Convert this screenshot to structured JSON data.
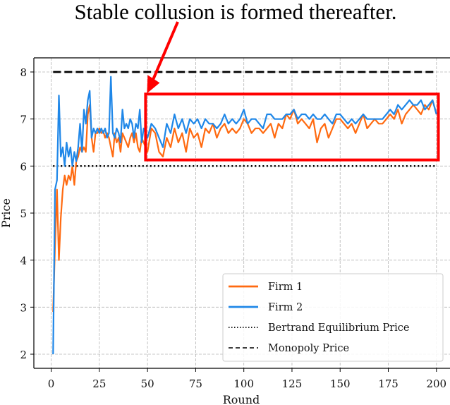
{
  "chart_data": {
    "type": "line",
    "title": "",
    "xlabel": "Round",
    "ylabel": "Price",
    "xlim": [
      -9,
      208.5
    ],
    "ylim": [
      1.7,
      8.3
    ],
    "xticks": [
      0,
      25,
      50,
      75,
      100,
      125,
      150,
      175,
      200
    ],
    "yticks": [
      2,
      3,
      4,
      5,
      6,
      7,
      8
    ],
    "grid": true,
    "legend_position": "bottom-right",
    "annotation": {
      "text": "Stable collusion is formed thereafter.",
      "box": {
        "x_range": [
          49,
          201
        ],
        "y_range": [
          6.13,
          7.53
        ],
        "color": "#ff0000"
      },
      "arrow_color": "#ff0000"
    },
    "reference_lines": [
      {
        "name": "Bertrand Equilibrium Price",
        "value": 6.0,
        "style": "dotted",
        "color": "#000000"
      },
      {
        "name": "Monopoly Price",
        "value": 8.0,
        "style": "dashed",
        "color": "#000000"
      }
    ],
    "x": [
      1,
      2,
      3,
      4,
      5,
      6,
      7,
      8,
      9,
      10,
      11,
      12,
      13,
      14,
      15,
      16,
      17,
      18,
      19,
      20,
      21,
      22,
      23,
      24,
      25,
      26,
      27,
      28,
      29,
      30,
      31,
      32,
      33,
      34,
      35,
      36,
      37,
      38,
      39,
      40,
      41,
      42,
      43,
      44,
      45,
      46,
      47,
      48,
      49,
      50,
      52,
      54,
      56,
      58,
      60,
      62,
      64,
      66,
      68,
      70,
      72,
      74,
      76,
      78,
      80,
      82,
      84,
      86,
      88,
      90,
      92,
      94,
      96,
      98,
      100,
      102,
      104,
      106,
      108,
      110,
      112,
      114,
      116,
      118,
      120,
      122,
      124,
      126,
      128,
      130,
      132,
      134,
      136,
      138,
      140,
      142,
      144,
      146,
      148,
      150,
      152,
      154,
      156,
      158,
      160,
      162,
      164,
      166,
      168,
      170,
      172,
      174,
      176,
      178,
      180,
      182,
      184,
      186,
      188,
      190,
      192,
      194,
      196,
      198,
      200
    ],
    "series": [
      {
        "name": "Firm 1",
        "color": "#ff6a10",
        "values": [
          2.9,
          4.3,
          5.5,
          4.0,
          4.9,
          5.5,
          5.8,
          5.6,
          5.8,
          5.7,
          6.0,
          5.6,
          6.1,
          6.2,
          6.4,
          6.3,
          6.4,
          6.3,
          7.1,
          7.3,
          6.6,
          6.3,
          6.7,
          6.7,
          6.8,
          6.7,
          6.75,
          6.6,
          6.7,
          6.6,
          6.4,
          6.2,
          6.7,
          6.5,
          6.6,
          6.3,
          6.7,
          6.6,
          6.5,
          6.4,
          6.6,
          6.7,
          6.5,
          6.7,
          6.4,
          6.3,
          6.6,
          6.5,
          6.4,
          6.3,
          6.8,
          6.7,
          6.3,
          6.2,
          6.6,
          6.4,
          6.8,
          6.5,
          6.7,
          6.3,
          6.8,
          6.6,
          6.7,
          6.4,
          6.8,
          6.7,
          6.9,
          6.6,
          6.8,
          6.9,
          6.7,
          6.8,
          6.7,
          6.8,
          7.0,
          6.9,
          6.7,
          6.8,
          6.8,
          6.7,
          6.8,
          6.9,
          6.6,
          6.9,
          6.8,
          7.1,
          7.0,
          7.2,
          6.9,
          7.0,
          6.9,
          6.8,
          7.0,
          6.5,
          6.8,
          6.9,
          6.6,
          6.8,
          7.0,
          7.0,
          6.9,
          6.8,
          6.9,
          6.7,
          6.9,
          7.1,
          6.8,
          6.9,
          7.0,
          6.9,
          6.9,
          7.0,
          7.1,
          7.0,
          7.2,
          6.9,
          7.1,
          7.2,
          7.3,
          7.2,
          7.1,
          7.3,
          7.2,
          7.4,
          7.1
        ]
      },
      {
        "name": "Firm 2",
        "color": "#1f87e8",
        "values": [
          2.0,
          5.5,
          5.7,
          7.5,
          6.2,
          6.4,
          6.0,
          6.5,
          6.2,
          6.4,
          6.0,
          6.3,
          6.1,
          6.4,
          6.9,
          6.3,
          7.2,
          6.9,
          7.4,
          7.6,
          6.6,
          6.8,
          6.7,
          6.8,
          6.7,
          6.8,
          6.7,
          6.8,
          6.6,
          6.7,
          7.9,
          6.7,
          6.6,
          6.8,
          6.7,
          6.5,
          7.2,
          6.8,
          6.9,
          6.8,
          7.0,
          6.9,
          6.6,
          6.9,
          6.8,
          7.2,
          6.5,
          6.8,
          6.7,
          6.6,
          6.9,
          6.8,
          6.6,
          6.4,
          6.9,
          6.7,
          7.1,
          6.8,
          7.0,
          6.7,
          7.0,
          6.9,
          7.0,
          6.8,
          7.0,
          6.9,
          6.9,
          6.8,
          6.9,
          7.1,
          6.9,
          7.0,
          6.9,
          7.0,
          7.2,
          6.9,
          7.0,
          7.0,
          6.9,
          6.8,
          7.1,
          7.1,
          7.0,
          7.0,
          7.0,
          7.1,
          7.1,
          7.2,
          7.0,
          7.1,
          7.1,
          7.0,
          7.1,
          7.0,
          7.0,
          7.1,
          7.0,
          6.9,
          7.1,
          7.1,
          7.0,
          6.9,
          7.0,
          6.9,
          7.0,
          7.1,
          7.0,
          7.0,
          7.0,
          7.0,
          7.0,
          7.1,
          7.2,
          7.1,
          7.3,
          7.2,
          7.3,
          7.4,
          7.3,
          7.3,
          7.4,
          7.2,
          7.3,
          7.4,
          7.1
        ]
      }
    ],
    "legend": [
      {
        "label": "Firm 1",
        "style": "solid",
        "color": "#ff6a10"
      },
      {
        "label": "Firm 2",
        "style": "solid",
        "color": "#1f87e8"
      },
      {
        "label": "Bertrand Equilibrium Price",
        "style": "dotted",
        "color": "#000000"
      },
      {
        "label": "Monopoly Price",
        "style": "dashed",
        "color": "#000000"
      }
    ]
  }
}
